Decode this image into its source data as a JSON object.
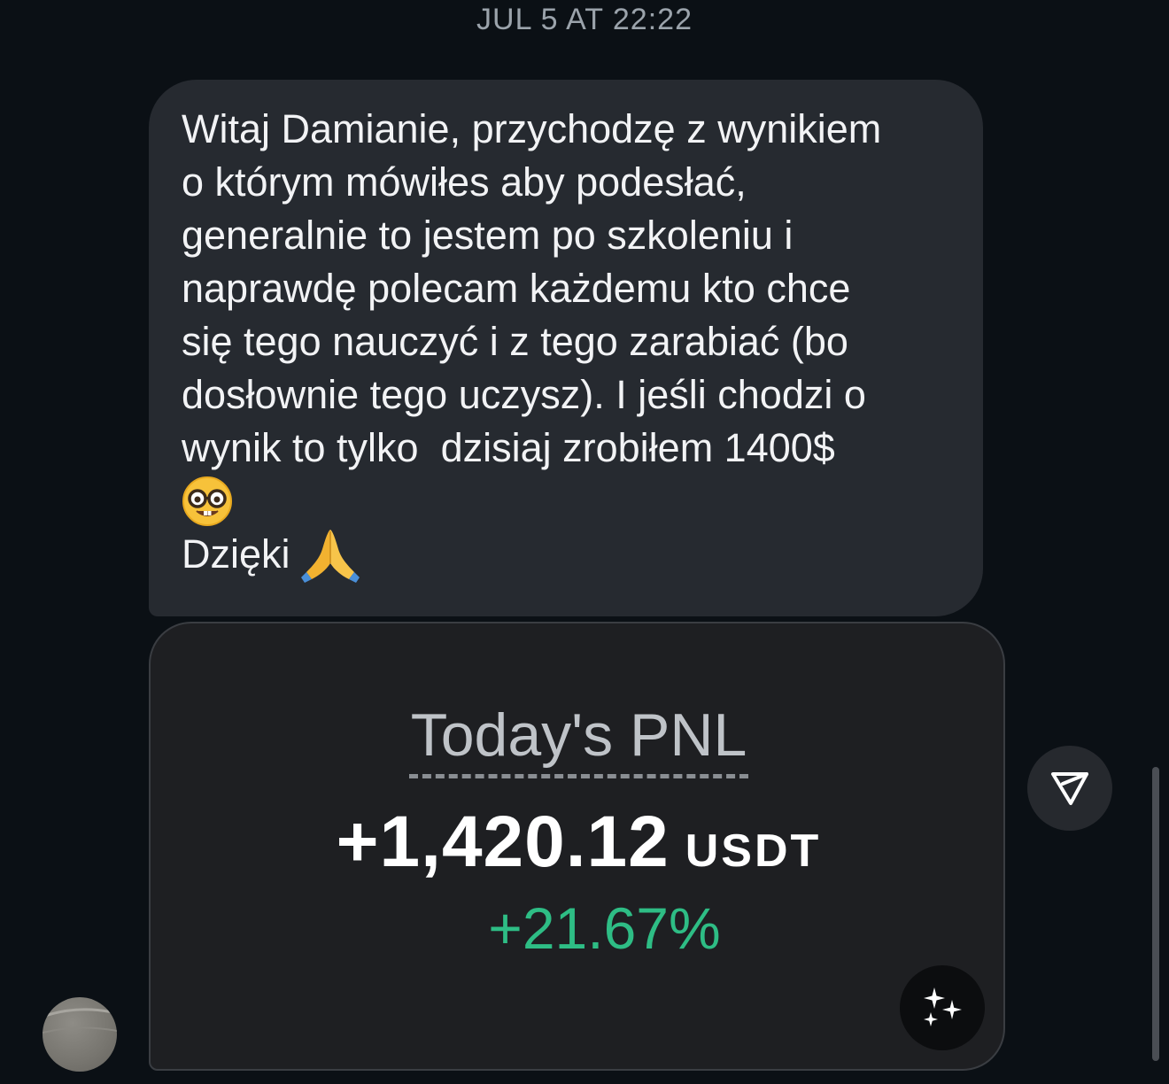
{
  "timestamp": "JUL 5 AT 22:22",
  "message": {
    "lines": [
      "Witaj Damianie, przychodzę z wynikiem",
      "o którym mówiłes aby podesłać,",
      "generalnie to jestem po szkoleniu i",
      "naprawdę polecam każdemu kto chce",
      "się tego nauczyć i z tego zarabiać (bo",
      "dosłownie tego uczysz). I jeśli chodzi o",
      "wynik to tylko  dzisiaj zrobiłem 1400$"
    ],
    "emoji_1": "nerd-face-emoji",
    "thanks_text": "Dzięki",
    "emoji_2": "folded-hands-emoji"
  },
  "attachment": {
    "title": "Today's PNL",
    "amount": "+1,420.12",
    "unit": "USDT",
    "percent": "+21.67%",
    "percent_color": "#2ebd85",
    "action_icon": "sparkles-icon"
  },
  "share_button": {
    "icon": "send-icon"
  },
  "avatar": {
    "icon": "avatar"
  }
}
